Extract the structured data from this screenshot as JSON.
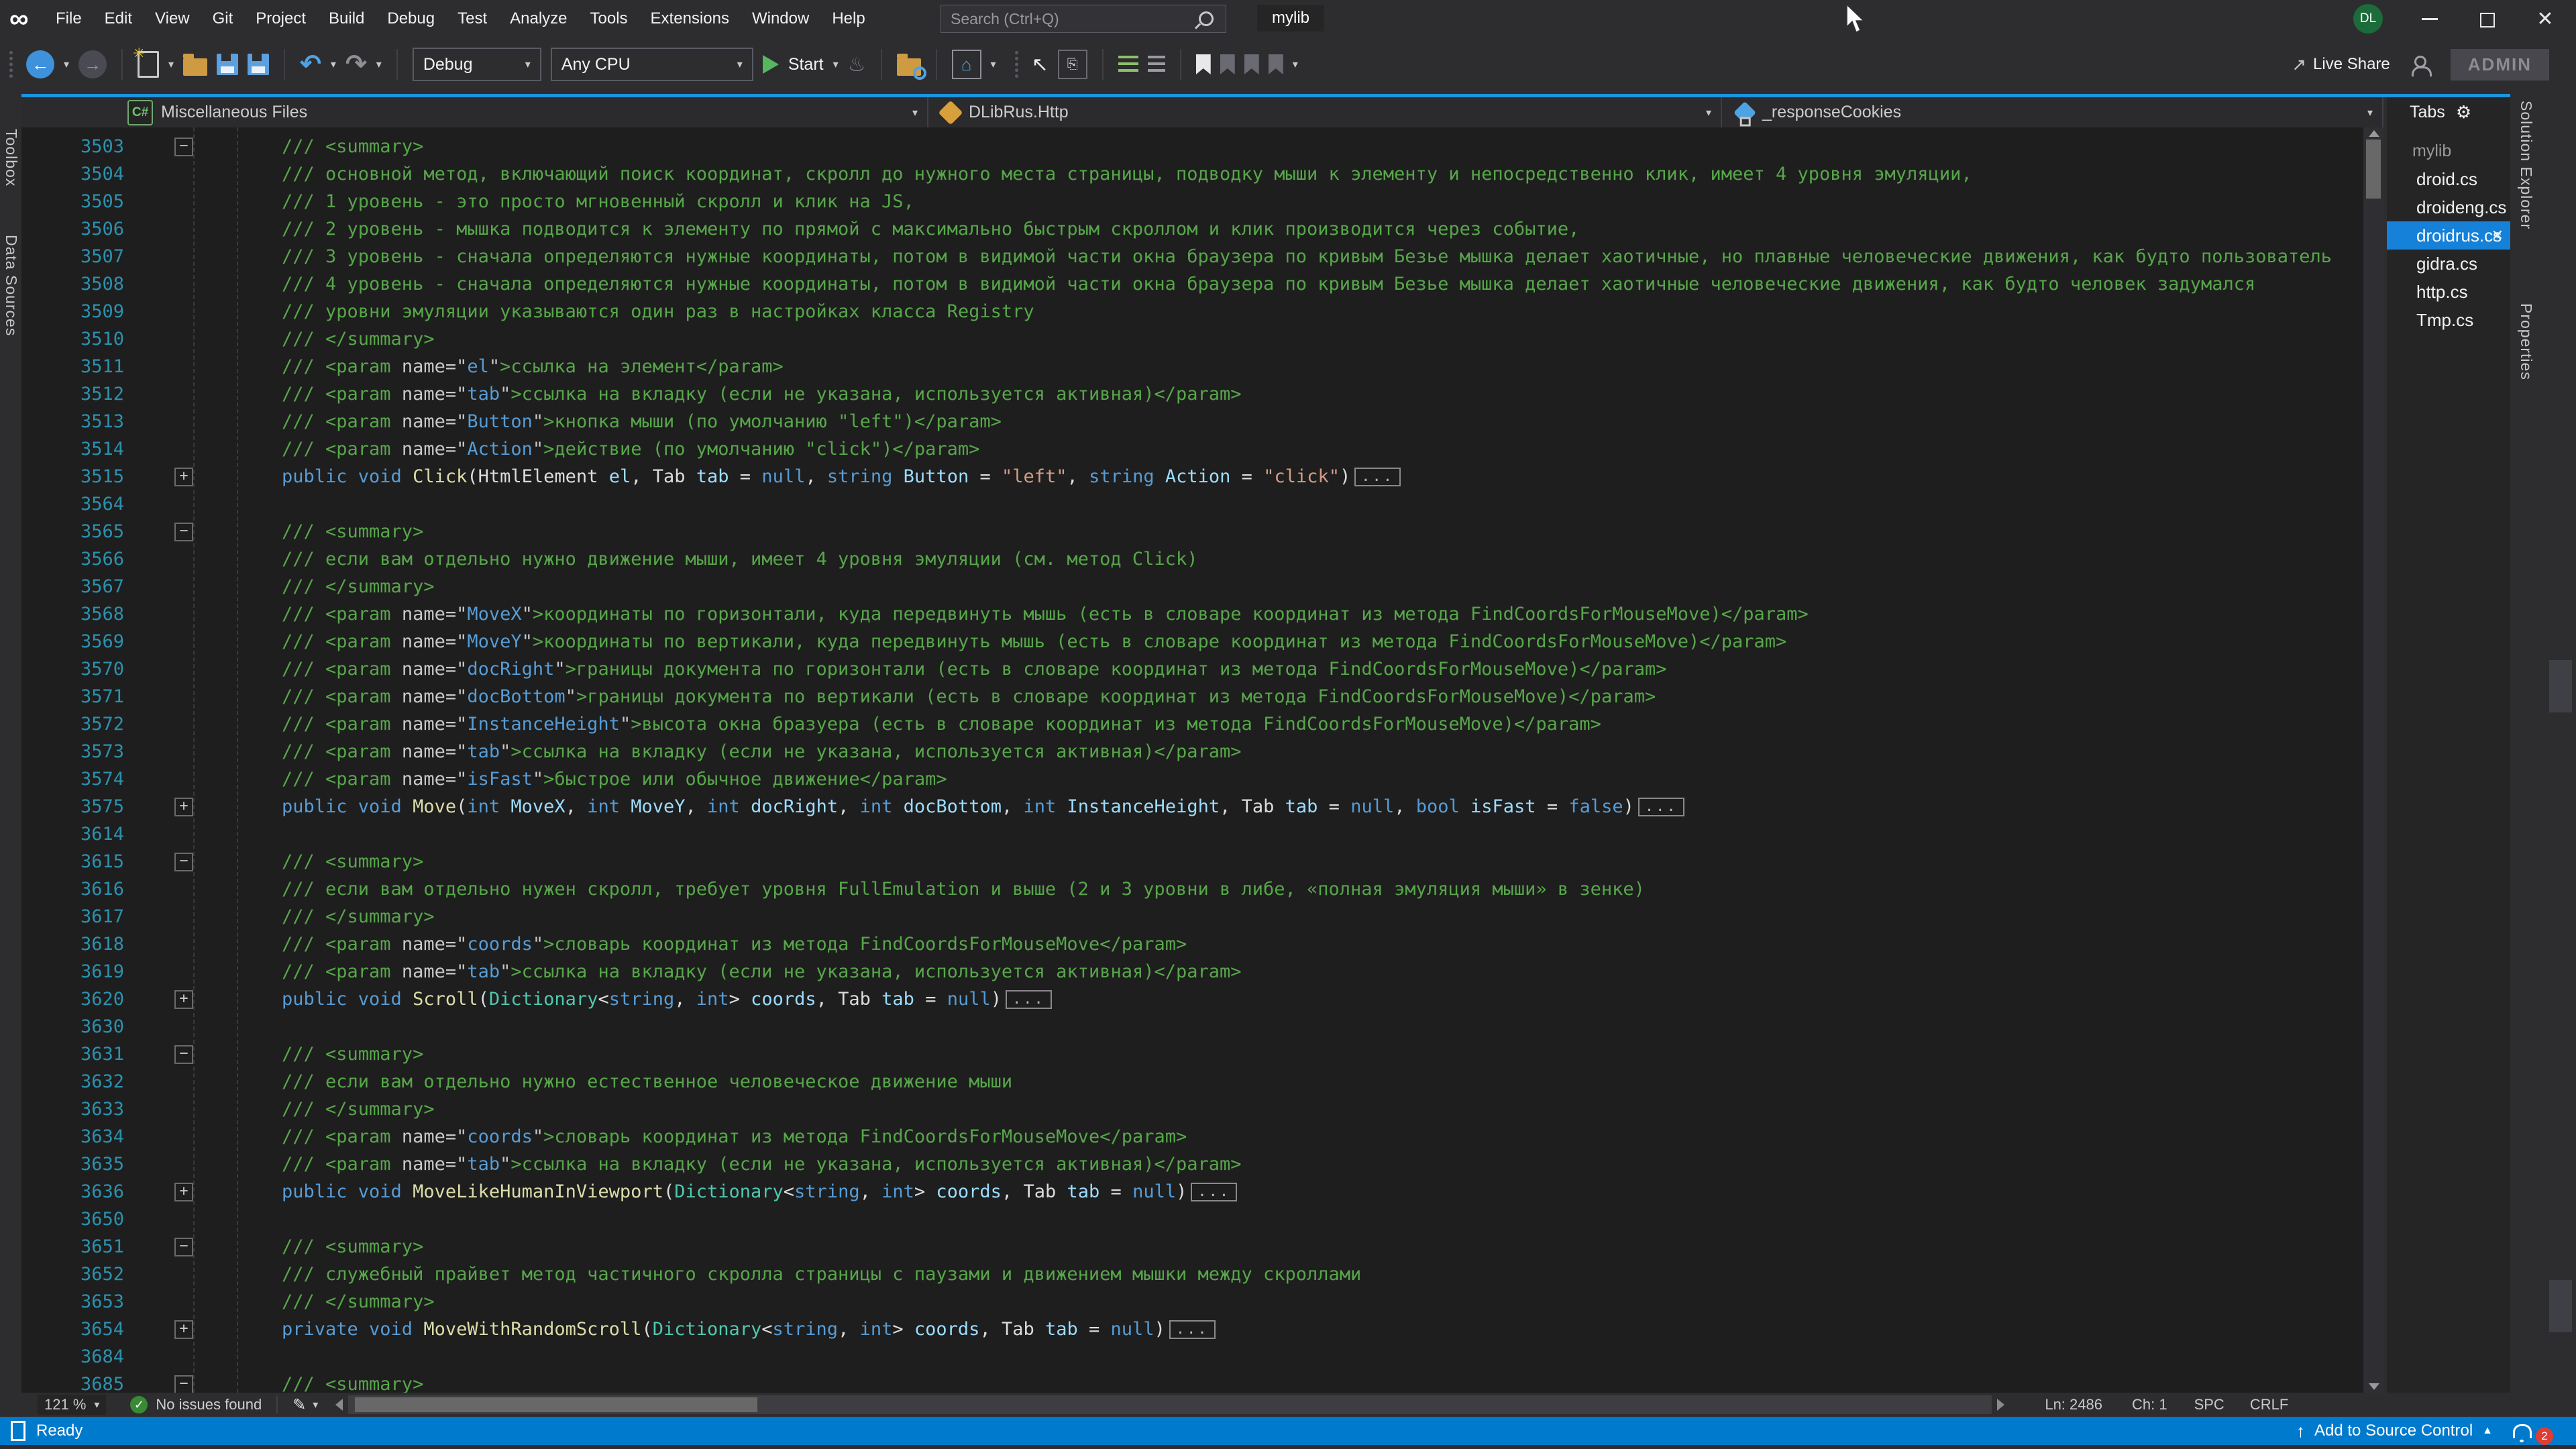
{
  "colors": {
    "accent": "#007ACC",
    "editor_bg": "#1E1E1E",
    "chrome_bg": "#2D2D30",
    "panel_bg": "#252526",
    "selection_blue": "#1581D8",
    "comment_green": "#57A64A",
    "keyword_blue": "#569CD6",
    "type_teal": "#4EC9B0",
    "method_yellow": "#DCDCAA",
    "param_blue": "#9CDCFE",
    "string_orange": "#D69D85",
    "line_number": "#2B91AF",
    "issues_green": "#388A34",
    "avatar_green": "#1C6B3A",
    "notification_red": "#E03C31"
  },
  "titlebar": {
    "logo": "∞",
    "menus": [
      "File",
      "Edit",
      "View",
      "Git",
      "Project",
      "Build",
      "Debug",
      "Test",
      "Analyze",
      "Tools",
      "Extensions",
      "Window",
      "Help"
    ],
    "search_placeholder": "Search (Ctrl+Q)",
    "project": "mylib",
    "avatar": "DL",
    "close": "✕"
  },
  "toolbar": {
    "back": "←",
    "forward": "→",
    "new_spark": "✳",
    "undo": "↶",
    "redo": "↷",
    "debug_config": "Debug",
    "platform": "Any CPU",
    "start": "Start",
    "hot_reload": "♨",
    "home": "⌂",
    "cursor": "↖",
    "live_share": "Live Share",
    "share_arrow": "↗",
    "admin": "ADMIN"
  },
  "navbar": {
    "scope_icon": "C#",
    "scope": "Miscellaneous Files",
    "type": "DLibRus.Http",
    "member": "_responseCookies",
    "splitter": "⇕",
    "tabs_title": "Tabs",
    "tabs_gear": "⚙"
  },
  "left_tabs": [
    "Toolbox",
    "Data Sources"
  ],
  "right_tabs": [
    "Solution Explorer",
    "Properties"
  ],
  "tabs_panel": {
    "group": "mylib",
    "files": [
      {
        "name": "droid.cs",
        "selected": false
      },
      {
        "name": "droideng.cs",
        "selected": false
      },
      {
        "name": "droidrus.cs",
        "selected": true
      },
      {
        "name": "gidra.cs",
        "selected": false
      },
      {
        "name": "http.cs",
        "selected": false
      },
      {
        "name": "Tmp.cs",
        "selected": false
      }
    ],
    "close_glyph": "✕"
  },
  "editor": {
    "lines": [
      {
        "n": "3503",
        "f": "-",
        "c": "/// <summary>"
      },
      {
        "n": "3504",
        "c": "/// основной метод, включающий поиск координат, скролл до нужного места страницы, подводку мыши к элементу и непосредственно клик, имеет 4 уровня эмуляции,"
      },
      {
        "n": "3505",
        "c": "/// 1 уровень - это просто мгновенный скролл и клик на JS,"
      },
      {
        "n": "3506",
        "c": "/// 2 уровень - мышка подводится к элементу по прямой с максимально быстрым скроллом и клик производится через событие,"
      },
      {
        "n": "3507",
        "c": "/// 3 уровень - сначала определяются нужные координаты, потом в видимой части окна браузера по кривым Безье мышка делает хаотичные, но плавные человеческие движения, как будто пользователь"
      },
      {
        "n": "3508",
        "c": "/// 4 уровень - сначала определяются нужные координаты, потом в видимой части окна браузера по кривым Безье мышка делает хаотичные человеческие движения, как будто человек задумался"
      },
      {
        "n": "3509",
        "c": "/// уровни эмуляции указываются один раз в настройках класса Registry"
      },
      {
        "n": "3510",
        "c": "/// </summary>"
      },
      {
        "n": "3511",
        "p": "el",
        "t": "ссылка на элемент"
      },
      {
        "n": "3512",
        "p": "tab",
        "t": "ссылка на вкладку (если не указана, используется активная)"
      },
      {
        "n": "3513",
        "p": "Button",
        "t": "кнопка мыши (по умолчанию \"left\")"
      },
      {
        "n": "3514",
        "p": "Action",
        "t": "действие (по умолчанию \"click\")"
      },
      {
        "n": "3515",
        "f": "+",
        "s": [
          [
            "k",
            "public void "
          ],
          [
            "m",
            "Click"
          ],
          [
            "d",
            "("
          ],
          [
            "d",
            "HtmlElement "
          ],
          [
            "p",
            "el"
          ],
          [
            "d",
            ", Tab "
          ],
          [
            "p",
            "tab"
          ],
          [
            "d",
            " = "
          ],
          [
            "k",
            "null"
          ],
          [
            "d",
            ", "
          ],
          [
            "k",
            "string "
          ],
          [
            "p",
            "Button"
          ],
          [
            "d",
            " = "
          ],
          [
            "s",
            "\"left\""
          ],
          [
            "d",
            ", "
          ],
          [
            "k",
            "string "
          ],
          [
            "p",
            "Action"
          ],
          [
            "d",
            " = "
          ],
          [
            "s",
            "\"click\""
          ],
          [
            "d",
            ")"
          ],
          [
            "x",
            "..."
          ]
        ]
      },
      {
        "n": "3564"
      },
      {
        "n": "3565",
        "f": "-",
        "c": "/// <summary>"
      },
      {
        "n": "3566",
        "c": "/// если вам отдельно нужно движение мыши, имеет 4 уровня эмуляции (см. метод Click)"
      },
      {
        "n": "3567",
        "c": "/// </summary>"
      },
      {
        "n": "3568",
        "p": "MoveX",
        "t": "координаты по горизонтали, куда передвинуть мышь (есть в словаре координат из метода FindCoordsForMouseMove)"
      },
      {
        "n": "3569",
        "p": "MoveY",
        "t": "координаты по вертикали, куда передвинуть мышь (есть в словаре координат из метода FindCoordsForMouseMove)"
      },
      {
        "n": "3570",
        "p": "docRight",
        "t": "границы документа по горизонтали (есть в словаре координат из метода FindCoordsForMouseMove)"
      },
      {
        "n": "3571",
        "p": "docBottom",
        "t": "границы документа по вертикали (есть в словаре координат из метода FindCoordsForMouseMove)"
      },
      {
        "n": "3572",
        "p": "InstanceHeight",
        "t": "высота окна бразуера (есть в словаре координат из метода FindCoordsForMouseMove)"
      },
      {
        "n": "3573",
        "p": "tab",
        "t": "ссылка на вкладку (если не указана, используется активная)"
      },
      {
        "n": "3574",
        "p": "isFast",
        "t": "быстрое или обычное движение"
      },
      {
        "n": "3575",
        "f": "+",
        "s": [
          [
            "k",
            "public void "
          ],
          [
            "m",
            "Move"
          ],
          [
            "d",
            "("
          ],
          [
            "k",
            "int "
          ],
          [
            "p",
            "MoveX"
          ],
          [
            "d",
            ", "
          ],
          [
            "k",
            "int "
          ],
          [
            "p",
            "MoveY"
          ],
          [
            "d",
            ", "
          ],
          [
            "k",
            "int "
          ],
          [
            "p",
            "docRight"
          ],
          [
            "d",
            ", "
          ],
          [
            "k",
            "int "
          ],
          [
            "p",
            "docBottom"
          ],
          [
            "d",
            ", "
          ],
          [
            "k",
            "int "
          ],
          [
            "p",
            "InstanceHeight"
          ],
          [
            "d",
            ", Tab "
          ],
          [
            "p",
            "tab"
          ],
          [
            "d",
            " = "
          ],
          [
            "k",
            "null"
          ],
          [
            "d",
            ", "
          ],
          [
            "k",
            "bool "
          ],
          [
            "p",
            "isFast"
          ],
          [
            "d",
            " = "
          ],
          [
            "k",
            "false"
          ],
          [
            "d",
            ")"
          ],
          [
            "x",
            "..."
          ]
        ]
      },
      {
        "n": "3614"
      },
      {
        "n": "3615",
        "f": "-",
        "c": "/// <summary>"
      },
      {
        "n": "3616",
        "c": "/// если вам отдельно нужен скролл, требует уровня FullEmulation и выше (2 и 3 уровни в либе, «полная эмуляция мыши» в зенке)"
      },
      {
        "n": "3617",
        "c": "/// </summary>"
      },
      {
        "n": "3618",
        "p": "coords",
        "t": "словарь координат из метода FindCoordsForMouseMove"
      },
      {
        "n": "3619",
        "p": "tab",
        "t": "ссылка на вкладку (если не указана, используется активная)"
      },
      {
        "n": "3620",
        "f": "+",
        "s": [
          [
            "k",
            "public void "
          ],
          [
            "m",
            "Scroll"
          ],
          [
            "d",
            "("
          ],
          [
            "t",
            "Dictionary"
          ],
          [
            "d",
            "<"
          ],
          [
            "k",
            "string"
          ],
          [
            "d",
            ", "
          ],
          [
            "k",
            "int"
          ],
          [
            "d",
            "> "
          ],
          [
            "p",
            "coords"
          ],
          [
            "d",
            ", Tab "
          ],
          [
            "p",
            "tab"
          ],
          [
            "d",
            " = "
          ],
          [
            "k",
            "null"
          ],
          [
            "d",
            ")"
          ],
          [
            "x",
            "..."
          ]
        ]
      },
      {
        "n": "3630"
      },
      {
        "n": "3631",
        "f": "-",
        "c": "/// <summary>"
      },
      {
        "n": "3632",
        "c": "/// если вам отдельно нужно естественное человеческое движение мыши"
      },
      {
        "n": "3633",
        "c": "/// </summary>"
      },
      {
        "n": "3634",
        "p": "coords",
        "t": "словарь координат из метода FindCoordsForMouseMove"
      },
      {
        "n": "3635",
        "p": "tab",
        "t": "ссылка на вкладку (если не указана, используется активная)"
      },
      {
        "n": "3636",
        "f": "+",
        "s": [
          [
            "k",
            "public void "
          ],
          [
            "m",
            "MoveLikeHumanInViewport"
          ],
          [
            "d",
            "("
          ],
          [
            "t",
            "Dictionary"
          ],
          [
            "d",
            "<"
          ],
          [
            "k",
            "string"
          ],
          [
            "d",
            ", "
          ],
          [
            "k",
            "int"
          ],
          [
            "d",
            "> "
          ],
          [
            "p",
            "coords"
          ],
          [
            "d",
            ", Tab "
          ],
          [
            "p",
            "tab"
          ],
          [
            "d",
            " = "
          ],
          [
            "k",
            "null"
          ],
          [
            "d",
            ")"
          ],
          [
            "x",
            "..."
          ]
        ]
      },
      {
        "n": "3650"
      },
      {
        "n": "3651",
        "f": "-",
        "c": "/// <summary>"
      },
      {
        "n": "3652",
        "c": "/// служебный прайвет метод частичного скролла страницы с паузами и движением мышки между скроллами"
      },
      {
        "n": "3653",
        "c": "/// </summary>"
      },
      {
        "n": "3654",
        "f": "+",
        "s": [
          [
            "k",
            "private void "
          ],
          [
            "m",
            "MoveWithRandomScroll"
          ],
          [
            "d",
            "("
          ],
          [
            "t",
            "Dictionary"
          ],
          [
            "d",
            "<"
          ],
          [
            "k",
            "string"
          ],
          [
            "d",
            ", "
          ],
          [
            "k",
            "int"
          ],
          [
            "d",
            "> "
          ],
          [
            "p",
            "coords"
          ],
          [
            "d",
            ", Tab "
          ],
          [
            "p",
            "tab"
          ],
          [
            "d",
            " = "
          ],
          [
            "k",
            "null"
          ],
          [
            "d",
            ")"
          ],
          [
            "x",
            "..."
          ]
        ]
      },
      {
        "n": "3684"
      },
      {
        "n": "3685",
        "f": "-",
        "c": "/// <summary>"
      }
    ]
  },
  "editor_status": {
    "zoom": "121 %",
    "issues": "No issues found",
    "check": "✓",
    "pen": "✎",
    "ln": "Ln: 2486",
    "ch": "Ch: 1",
    "spc": "SPC",
    "eol": "CRLF"
  },
  "status_bar": {
    "ready": "Ready",
    "up_arrow": "↑",
    "source_control": "Add to Source Control",
    "up_chev": "▲",
    "notif_count": "2"
  }
}
